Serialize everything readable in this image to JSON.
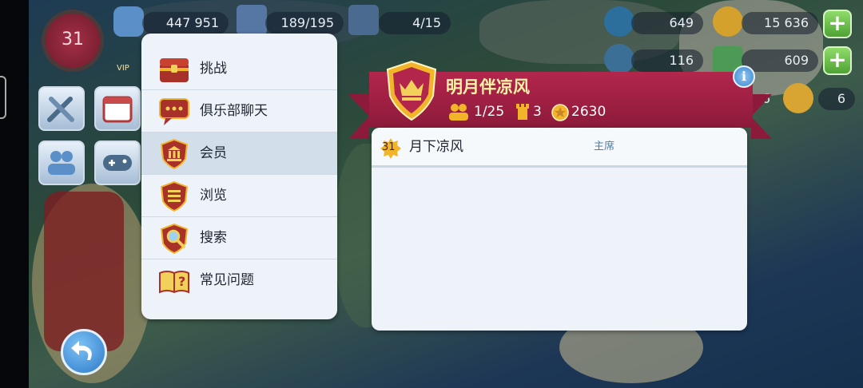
{
  "hud": {
    "level": "31",
    "population": "447 951",
    "storage": "189/195",
    "trains": "4/15",
    "simcash": "649",
    "simoleons": "15 636",
    "fish": "116",
    "cash2": "609",
    "side_left": "6",
    "keys": "6",
    "vip": "VIP"
  },
  "menu": {
    "items": [
      {
        "label": "挑战",
        "icon": "treasure-chest-icon"
      },
      {
        "label": "俱乐部聊天",
        "icon": "chat-bubble-icon"
      },
      {
        "label": "会员",
        "icon": "bank-shield-icon"
      },
      {
        "label": "浏览",
        "icon": "list-shield-icon"
      },
      {
        "label": "搜索",
        "icon": "search-shield-icon"
      },
      {
        "label": "常见问题",
        "icon": "question-book-icon"
      }
    ],
    "selected": 2
  },
  "club": {
    "name": "明月伴凉风",
    "members": "1/25",
    "towers": "3",
    "points": "2630"
  },
  "member_list": [
    {
      "level": "31",
      "name": "月下凉风",
      "role": "主席"
    }
  ],
  "colors": {
    "banner": "#b3264c",
    "panel": "#edf3f9",
    "accent_gold": "#f2b52a"
  }
}
